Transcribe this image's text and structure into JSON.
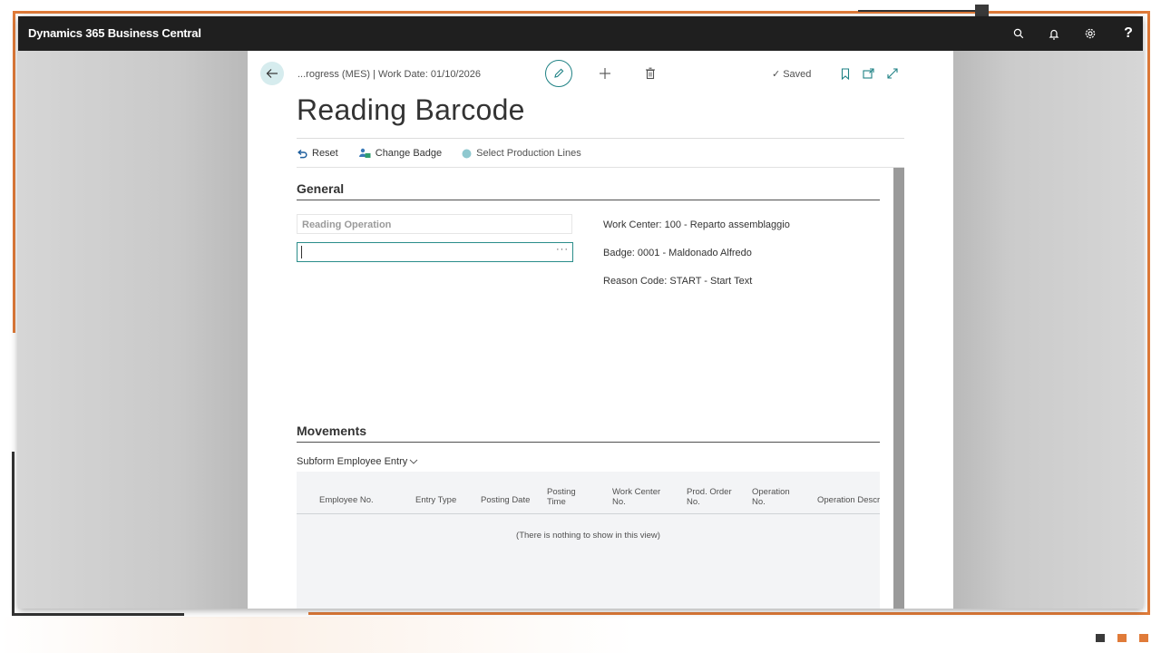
{
  "app": {
    "title": "Dynamics 365 Business Central"
  },
  "topbar": {
    "icons": [
      "search-icon",
      "bell-icon",
      "gear-icon",
      "help-icon"
    ],
    "help_label": "?"
  },
  "page": {
    "breadcrumb": "...rogress (MES) | Work Date: 01/10/2026",
    "title": "Reading Barcode",
    "saved_label": "Saved",
    "saved_check": "✓"
  },
  "actions": {
    "reset": "Reset",
    "change_badge": "Change Badge",
    "select_production_lines": "Select Production Lines"
  },
  "general": {
    "section_title": "General",
    "reading_operation_label": "Reading Operation",
    "reading_operation_value": "",
    "ellipsis": "···",
    "work_center": "Work Center: 100 - Reparto assemblaggio",
    "badge": "Badge: 0001 - Maldonado Alfredo",
    "reason_code": "Reason Code: START - Start Text"
  },
  "movements": {
    "section_title": "Movements",
    "subform_label": "Subform Employee Entry",
    "columns": [
      {
        "line1": "Employee No.",
        "line2": ""
      },
      {
        "line1": "Entry Type",
        "line2": ""
      },
      {
        "line1": "Posting Date",
        "line2": ""
      },
      {
        "line1": "Posting",
        "line2": "Time"
      },
      {
        "line1": "Work Center",
        "line2": "No."
      },
      {
        "line1": "Prod. Order",
        "line2": "No."
      },
      {
        "line1": "Operation",
        "line2": "No."
      },
      {
        "line1": "Operation Descr",
        "line2": ""
      }
    ],
    "empty_message": "(There is nothing to show in this view)"
  },
  "colors": {
    "accent": "#1e8184",
    "topbar": "#1f1f1f",
    "frame_orange": "#e07b39"
  }
}
